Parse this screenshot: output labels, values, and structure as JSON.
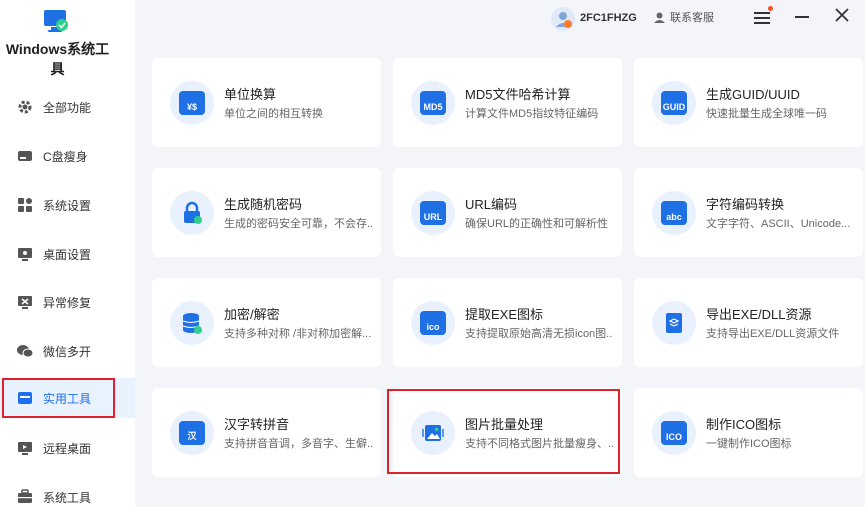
{
  "app": {
    "title": "Windows系统工具"
  },
  "topbar": {
    "user_id": "2FC1FHZG",
    "support_label": "联系客服"
  },
  "sidebar": {
    "items": [
      {
        "label": "全部功能",
        "icon": "gear-icon"
      },
      {
        "label": "C盘瘦身",
        "icon": "disk-icon"
      },
      {
        "label": "系统设置",
        "icon": "grid-icon"
      },
      {
        "label": "桌面设置",
        "icon": "monitor-icon"
      },
      {
        "label": "异常修复",
        "icon": "repair-icon"
      },
      {
        "label": "微信多开",
        "icon": "wechat-icon"
      },
      {
        "label": "实用工具",
        "icon": "toolbox-icon",
        "active": true
      },
      {
        "label": "远程桌面",
        "icon": "remote-icon"
      },
      {
        "label": "系统工具",
        "icon": "briefcase-icon"
      }
    ]
  },
  "tools": [
    {
      "title": "单位换算",
      "desc": "单位之间的相互转换",
      "icon": "unit-convert-icon",
      "glyph": "¥$"
    },
    {
      "title": "MD5文件哈希计算",
      "desc": "计算文件MD5指纹特征编码",
      "icon": "md5-icon",
      "glyph": "MD5"
    },
    {
      "title": "生成GUID/UUID",
      "desc": "快速批量生成全球唯一码",
      "icon": "guid-icon",
      "glyph": "GUID"
    },
    {
      "title": "生成随机密码",
      "desc": "生成的密码安全可靠，不会存..",
      "icon": "lock-icon",
      "glyph": ""
    },
    {
      "title": "URL编码",
      "desc": "确保URL的正确性和可解析性",
      "icon": "url-icon",
      "glyph": "URL"
    },
    {
      "title": "字符编码转换",
      "desc": "文字字符、ASCII、Unicode...",
      "icon": "abc-icon",
      "glyph": "abc"
    },
    {
      "title": "加密/解密",
      "desc": "支持多种对称 /非对称加密解...",
      "icon": "database-lock-icon",
      "glyph": ""
    },
    {
      "title": "提取EXE图标",
      "desc": "支持提取原始高清无损icon图..",
      "icon": "ico-extract-icon",
      "glyph": "ico"
    },
    {
      "title": "导出EXE/DLL资源",
      "desc": "支持导出EXE/DLL资源文件",
      "icon": "export-layers-icon",
      "glyph": ""
    },
    {
      "title": "汉字转拼音",
      "desc": "支持拼音音调，多音字、生僻..",
      "icon": "pinyin-icon",
      "glyph": "汉"
    },
    {
      "title": "图片批量处理",
      "desc": "支持不同格式图片批量瘦身、..",
      "icon": "image-batch-icon",
      "glyph": ""
    },
    {
      "title": "制作ICO图标",
      "desc": "一键制作ICO图标",
      "icon": "ico-make-icon",
      "glyph": "ICO"
    }
  ],
  "colors": {
    "accent": "#1d6ff2",
    "highlight": "#e0202a",
    "icon_blue": "#1f6fe5"
  }
}
